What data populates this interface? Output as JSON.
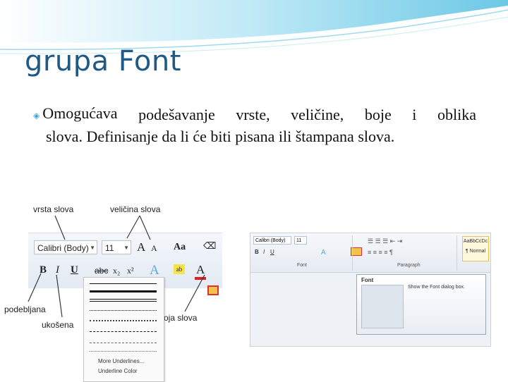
{
  "slide": {
    "title": "grupa Font",
    "bullet_line1_words": [
      "Omogućava",
      "podešavanje",
      "vrste,",
      "veličine,",
      "boje",
      "i",
      "oblika"
    ],
    "bullet_line2": "slova. Definisanje da li će biti pisana ili štampana slova."
  },
  "labels": {
    "vrsta": "vrsta slova",
    "velicina": "veličina slova",
    "podebljana": "podebljana",
    "ukosena": "ukošena",
    "boja": "oja slova"
  },
  "ribbon_left": {
    "font_name": "Calibri (Body)",
    "font_size": "11",
    "bold": "B",
    "italic": "I",
    "underline": "U",
    "strike": "abc",
    "sub": "x₂",
    "sup": "x²",
    "grow": "A",
    "shrink": "A",
    "change_case": "Aa",
    "font_color": "A"
  },
  "underline_menu": {
    "more": "More Underlines...",
    "color": "Underline Color"
  },
  "ribbon_right": {
    "font_name": "Calibri (Body)",
    "font_size": "11",
    "group_font": "Font",
    "group_paragraph": "Paragraph",
    "style_sample": "AaBbCcDc",
    "style_name": "¶ Normal",
    "tooltip_title": "Font",
    "tooltip_text": "Show the Font dialog box."
  },
  "colors": {
    "title": "#1f5a86",
    "wave": "#7fd3ec",
    "arrow": "#3a3a3a",
    "font_color_bar": "#e02020",
    "launcher_highlight": "#f3c44b"
  }
}
